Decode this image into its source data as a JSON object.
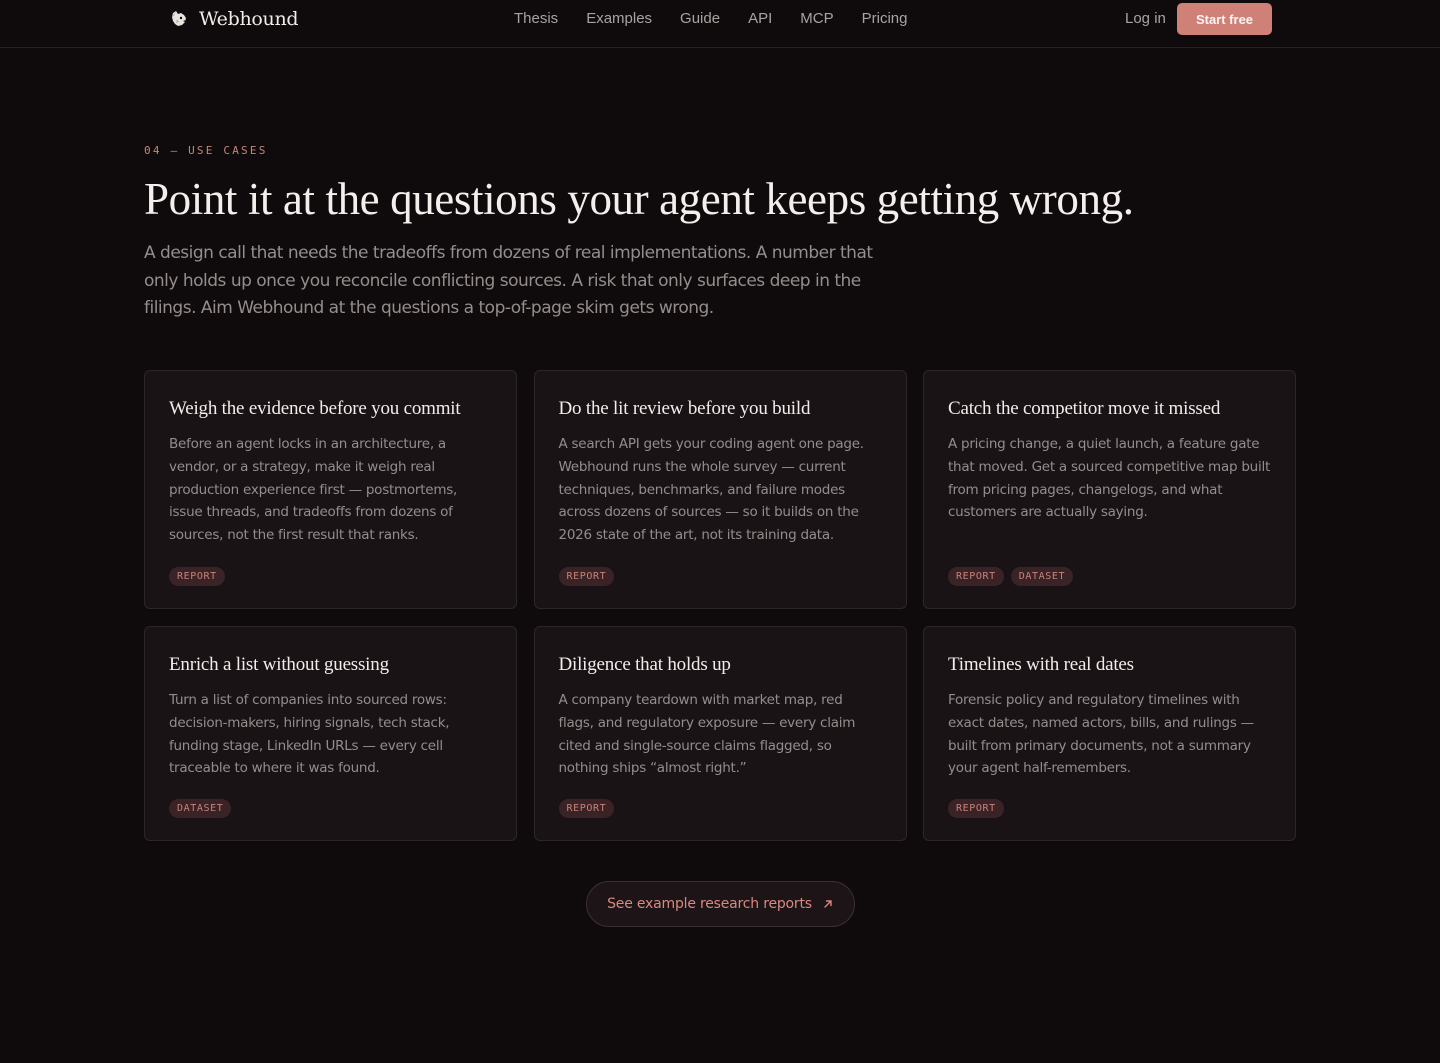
{
  "nav": {
    "brand_name": "Webhound",
    "brand_icon": "dog-head-icon",
    "links": [
      {
        "label": "Thesis"
      },
      {
        "label": "Examples"
      },
      {
        "label": "Guide"
      },
      {
        "label": "API"
      },
      {
        "label": "MCP"
      },
      {
        "label": "Pricing"
      }
    ],
    "login_label": "Log in",
    "cta_label": "Start free"
  },
  "section": {
    "eyebrow": "04 — USE CASES",
    "headline": "Point it at the questions your agent keeps getting wrong.",
    "lede": "A design call that needs the tradeoffs from dozens of real implementations. A number that only holds up once you reconcile conflicting sources. A risk that only surfaces deep in the filings. Aim Webhound at the questions a top-of-page skim gets wrong."
  },
  "cards": [
    {
      "title": "Weigh the evidence before you commit",
      "body": "Before an agent locks in an architecture, a vendor, or a strategy, make it weigh real production experience first — postmortems, issue threads, and tradeoffs from dozens of sources, not the first result that ranks.",
      "tags": [
        "REPORT"
      ]
    },
    {
      "title": "Do the lit review before you build",
      "body": "A search API gets your coding agent one page. Webhound runs the whole survey — current techniques, benchmarks, and failure modes across dozens of sources — so it builds on the 2026 state of the art, not its training data.",
      "tags": [
        "REPORT"
      ]
    },
    {
      "title": "Catch the competitor move it missed",
      "body": "A pricing change, a quiet launch, a feature gate that moved. Get a sourced competitive map built from pricing pages, changelogs, and what customers are actually saying.",
      "tags": [
        "REPORT",
        "DATASET"
      ]
    },
    {
      "title": "Enrich a list without guessing",
      "body": "Turn a list of companies into sourced rows: decision-makers, hiring signals, tech stack, funding stage, LinkedIn URLs — every cell traceable to where it was found.",
      "tags": [
        "DATASET"
      ]
    },
    {
      "title": "Diligence that holds up",
      "body": "A company teardown with market map, red flags, and regulatory exposure — every claim cited and single-source claims flagged, so nothing ships “almost right.”",
      "tags": [
        "REPORT"
      ]
    },
    {
      "title": "Timelines with real dates",
      "body": "Forensic policy and regulatory timelines with exact dates, named actors, bills, and rulings — built from primary documents, not a summary your agent half-remembers.",
      "tags": [
        "REPORT"
      ]
    }
  ],
  "cta": {
    "label": "See example research reports",
    "icon": "arrow-up-right-icon"
  },
  "colors": {
    "background": "#0f0b0c",
    "card": "#1a1316",
    "accent": "#cf8077",
    "tag_bg": "#3a2327",
    "muted_text": "#958d8b"
  }
}
